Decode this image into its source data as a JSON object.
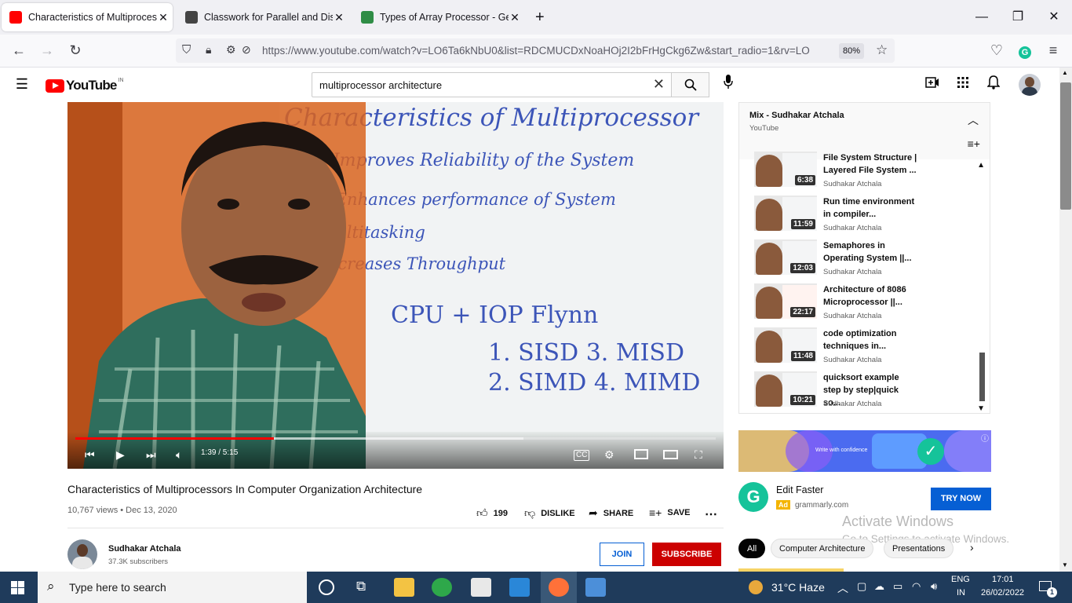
{
  "browser": {
    "tabs": [
      {
        "title": "Characteristics of Multiprocessors",
        "active": true
      },
      {
        "title": "Classwork for Parallel and Distri",
        "active": false
      },
      {
        "title": "Types of Array Processor - Geek",
        "active": false
      }
    ],
    "new_tab": "+",
    "url": "https://www.youtube.com/watch?v=LO6Ta6kNbU0&list=RDCMUCDxNoaHOj2I2bFrHgCkg6Zw&start_radio=1&rv=LO",
    "zoom": "80%"
  },
  "youtube": {
    "logo_text": "YouTube",
    "logo_country": "IN",
    "search_value": "multiprocessor architecture"
  },
  "video": {
    "whiteboard": {
      "heading": "Characteristics of Multiprocessor",
      "lines": [
        "1. Improves Reliability of the System",
        "2. Enhances performance of System",
        "3. Multitasking",
        "4. Increases Throughput"
      ],
      "flynn": "CPU + IOP  Flynn",
      "sisd_misd": "1. SISD  3. MISD",
      "simd_mimd": "2. SIMD  4. MIMD"
    },
    "time": "1:39 / 5:15",
    "progress_fraction": 0.31,
    "buffered_fraction": 0.7,
    "title": "Characteristics of Multiprocessors In Computer Organization Architecture",
    "meta": "10,767 views • Dec 13, 2020",
    "likes": "199",
    "dislike_label": "DISLIKE",
    "share_label": "SHARE",
    "save_label": "SAVE"
  },
  "channel": {
    "name": "Sudhakar Atchala",
    "subscribers": "37.3K subscribers",
    "join_label": "JOIN",
    "subscribe_label": "SUBSCRIBE"
  },
  "playlist": {
    "title": "Mix - Sudhakar Atchala",
    "subtitle": "YouTube",
    "items": [
      {
        "title": "File System Structure | Layered File System ...",
        "channel": "Sudhakar Atchala",
        "duration": "6:38"
      },
      {
        "title": "Run time environment in compiler...",
        "channel": "Sudhakar Atchala",
        "duration": "11:59"
      },
      {
        "title": "Semaphores in Operating System ||...",
        "channel": "Sudhakar Atchala",
        "duration": "12:03"
      },
      {
        "title": "Architecture of 8086 Microprocessor ||...",
        "channel": "Sudhakar Atchala",
        "duration": "22:17"
      },
      {
        "title": "code optimization techniques in...",
        "channel": "Sudhakar Atchala",
        "duration": "11:48"
      },
      {
        "title": "quicksort example step by step|quick so...",
        "channel": "Sudhakar Atchala",
        "duration": "10:21"
      }
    ]
  },
  "ad": {
    "banner_text": "Write with confidence",
    "title": "Edit Faster",
    "badge": "Ad",
    "domain": "grammarly.com",
    "cta": "TRY NOW"
  },
  "activation": {
    "line1": "Activate Windows",
    "line2": "Go to Settings to activate Windows."
  },
  "chips": [
    "All",
    "Computer Architecture",
    "Presentations"
  ],
  "taskbar": {
    "search_placeholder": "Type here to search",
    "weather": "31°C  Haze",
    "lang1": "ENG",
    "lang2": "IN",
    "time": "17:01",
    "date": "26/02/2022",
    "notification_count": "1"
  },
  "colors": {
    "yt_red": "#ff0000",
    "subscribe": "#cc0000",
    "join_blue": "#065fd4",
    "taskbar": "#1f3b5b"
  }
}
